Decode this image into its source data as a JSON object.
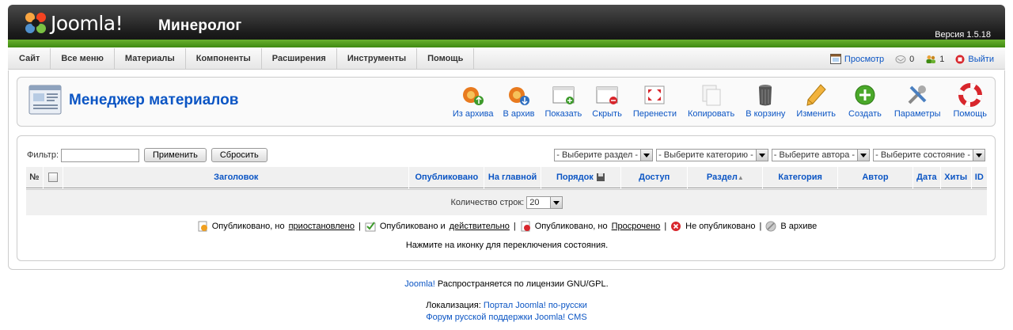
{
  "header": {
    "logo_text": "Joomla!",
    "site_name": "Минеролог",
    "version": "Версия 1.5.18"
  },
  "menu": {
    "items": [
      "Сайт",
      "Все меню",
      "Материалы",
      "Компоненты",
      "Расширения",
      "Инструменты",
      "Помощь"
    ],
    "right": {
      "preview": "Просмотр",
      "messages_count": "0",
      "users_count": "1",
      "logout": "Выйти"
    }
  },
  "toolbar": {
    "title": "Менеджер материалов",
    "buttons": [
      {
        "label": "Из архива",
        "icon": "unarchive-icon"
      },
      {
        "label": "В архив",
        "icon": "archive-icon"
      },
      {
        "label": "Показать",
        "icon": "publish-icon"
      },
      {
        "label": "Скрыть",
        "icon": "unpublish-icon"
      },
      {
        "label": "Перенести",
        "icon": "move-icon"
      },
      {
        "label": "Копировать",
        "icon": "copy-icon"
      },
      {
        "label": "В корзину",
        "icon": "trash-icon"
      },
      {
        "label": "Изменить",
        "icon": "edit-icon"
      },
      {
        "label": "Создать",
        "icon": "new-icon"
      },
      {
        "label": "Параметры",
        "icon": "config-icon"
      },
      {
        "label": "Помощь",
        "icon": "help-icon"
      }
    ]
  },
  "filter": {
    "label": "Фильтр:",
    "value": "",
    "apply": "Применить",
    "reset": "Сбросить",
    "selects": [
      "- Выберите раздел -",
      "- Выберите категорию -",
      "- Выберите автора -",
      "- Выберите состояние -"
    ]
  },
  "table": {
    "columns": [
      "№",
      "",
      "Заголовок",
      "Опубликовано",
      "На главной",
      "Порядок",
      "Доступ",
      "Раздел",
      "Категория",
      "Автор",
      "Дата",
      "Хиты",
      "ID"
    ],
    "rows_label": "Количество строк:",
    "rows_value": "20"
  },
  "legend": {
    "pending_prefix": "Опубликовано, но",
    "pending_link": "приостановлено",
    "current_prefix": "Опубликовано и",
    "current_link": "действительно",
    "expired_prefix": "Опубликовано, но",
    "expired_link": "Просрочено",
    "unpublished": "Не опубликовано",
    "archived": "В архиве",
    "separator": "|",
    "hint": "Нажмите на иконку для переключения состояния."
  },
  "footer": {
    "joomla_link": "Joomla!",
    "license_text": "Распространяется по лицензии GNU/GPL.",
    "localization_label": "Локализация:",
    "portal_link": "Портал Joomla! по-русски",
    "forum_link": "Форум русской поддержки Joomla! CMS"
  },
  "colors": {
    "link": "#0b55c4",
    "header_dark": "#1a1a1a",
    "header_green": "#4f9a1c"
  }
}
